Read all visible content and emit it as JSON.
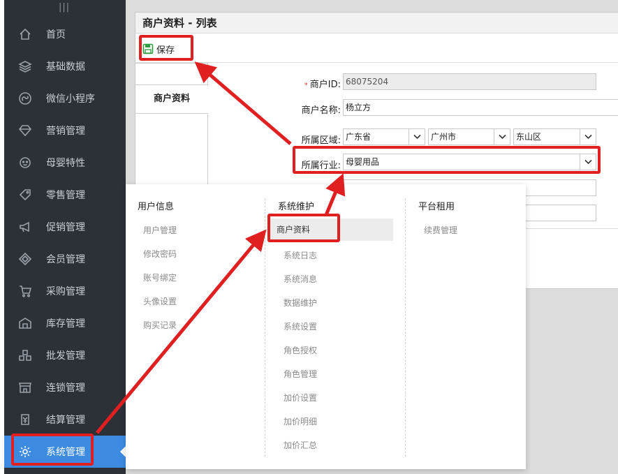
{
  "sidebar": {
    "handle_icon": "grip-icon",
    "items": [
      {
        "label": "首页",
        "icon": "home-icon"
      },
      {
        "label": "基础数据",
        "icon": "layers-icon"
      },
      {
        "label": "微信小程序",
        "icon": "miniprogram-icon"
      },
      {
        "label": "营销管理",
        "icon": "diamond-icon"
      },
      {
        "label": "母婴特性",
        "icon": "baby-face-icon"
      },
      {
        "label": "零售管理",
        "icon": "tag-icon"
      },
      {
        "label": "促销管理",
        "icon": "megaphone-icon"
      },
      {
        "label": "会员管理",
        "icon": "member-diamond-icon"
      },
      {
        "label": "采购管理",
        "icon": "cart-icon"
      },
      {
        "label": "库存管理",
        "icon": "warehouse-icon"
      },
      {
        "label": "批发管理",
        "icon": "boxes-icon"
      },
      {
        "label": "连锁管理",
        "icon": "store-icon"
      },
      {
        "label": "结算管理",
        "icon": "settlement-icon"
      },
      {
        "label": "系统管理",
        "icon": "gear-icon"
      }
    ],
    "active_index": 13
  },
  "panel": {
    "title": "商户资料 - 列表",
    "save_label": "保存",
    "tab_label": "商户资料"
  },
  "form": {
    "merchant_id_label": "商户ID:",
    "merchant_id_value": "68075204",
    "merchant_name_label": "商户名称:",
    "merchant_name_value": "杨立方",
    "region_label": "所属区域:",
    "province": "广东省",
    "city": "广州市",
    "district": "东山区",
    "industry_label": "所属行业:",
    "industry_value": "母婴用品"
  },
  "menu": {
    "columns": [
      {
        "title": "用户信息",
        "items": [
          "用户管理",
          "修改密码",
          "账号绑定",
          "头像设置",
          "购买记录"
        ]
      },
      {
        "title": "系统维护",
        "items": [
          "商户资料",
          "系统日志",
          "系统消息",
          "数据维护",
          "系统设置",
          "角色授权",
          "角色管理",
          "加价设置",
          "加价明细",
          "加价汇总"
        ],
        "highlighted": 0
      },
      {
        "title": "平台租用",
        "items": [
          "续费管理"
        ]
      }
    ]
  },
  "colors": {
    "sidebar_bg": "#2b3137",
    "active_bg": "#3d8be0",
    "annotation": "#e02020",
    "save_icon": "#2e9b3e"
  }
}
